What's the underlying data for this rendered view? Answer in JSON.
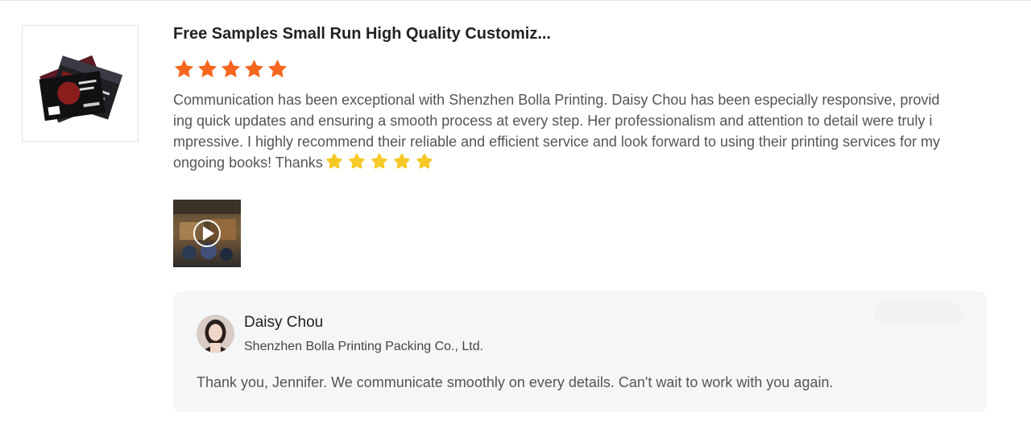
{
  "review": {
    "product_title": "Free Samples Small Run High Quality Customiz...",
    "rating": 5,
    "text": "Communication has been exceptional with Shenzhen Bolla Printing. Daisy Chou has been especially responsive, providing quick updates and ensuring a smooth process at every step. Her professionalism and attention to detail were truly impressive. I highly recommend their reliable and efficient service and look forward to using their printing services for my ongoing books! Thanks",
    "emoji_stars": 5
  },
  "reply": {
    "seller_name": "Daisy Chou",
    "company": "Shenzhen Bolla Printing Packing Co., Ltd.",
    "text": "Thank you, Jennifer. We communicate smoothly on every details. Can't wait to work with you again."
  },
  "colors": {
    "rating_star": "#f4651d",
    "emoji_star": "#f7c928",
    "reply_bg": "#f5f6f8"
  },
  "icons": {
    "rating": "star-icon",
    "emoji": "emoji-star-icon",
    "video": "play-icon"
  }
}
